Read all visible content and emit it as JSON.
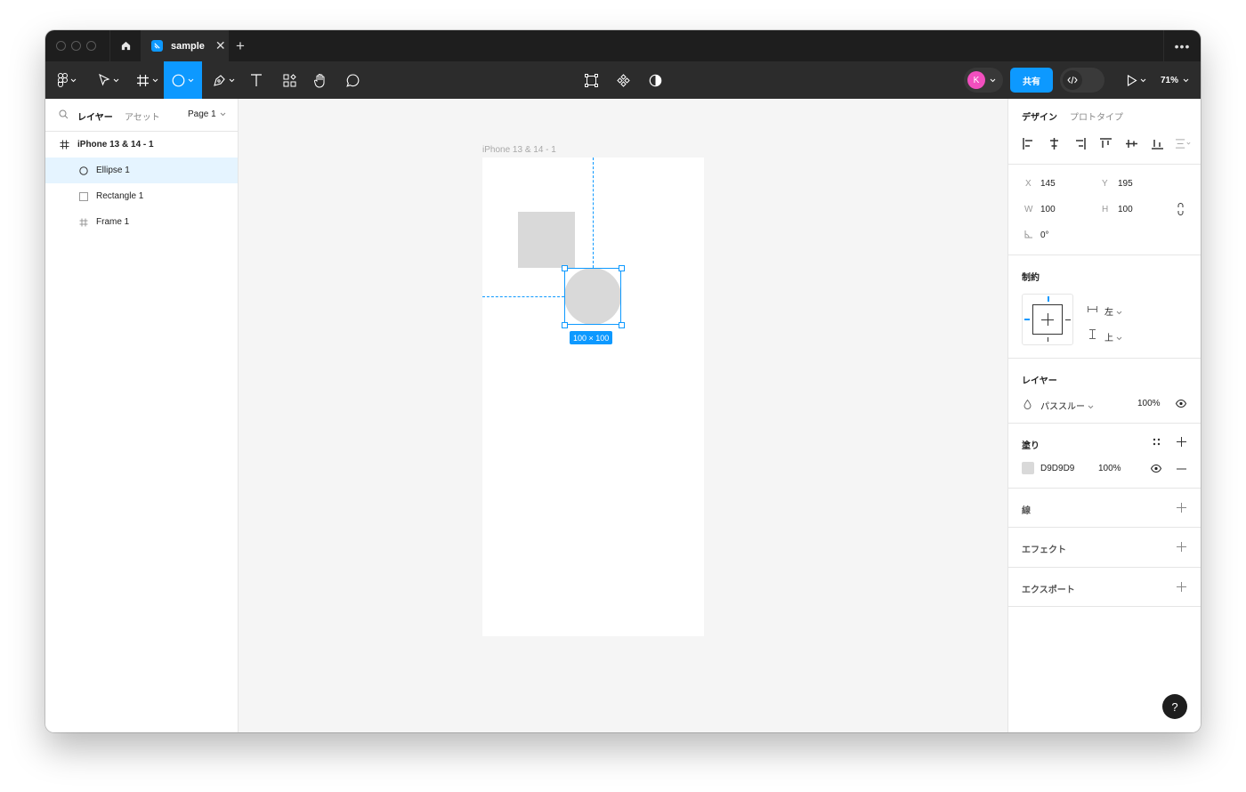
{
  "tabbar": {
    "file_title": "sample",
    "close_glyph": "✕",
    "add_glyph": "+",
    "more_glyph": "•••"
  },
  "toolbar": {
    "avatar_initial": "K",
    "share_label": "共有",
    "zoom": "71%"
  },
  "layers_panel": {
    "tab_layers": "レイヤー",
    "tab_assets": "アセット",
    "page": "Page 1",
    "items": [
      {
        "label": "iPhone 13 & 14 - 1",
        "icon": "frame-icon"
      },
      {
        "label": "Ellipse 1",
        "icon": "ellipse-icon"
      },
      {
        "label": "Rectangle 1",
        "icon": "rectangle-icon"
      },
      {
        "label": "Frame 1",
        "icon": "frame-icon"
      }
    ]
  },
  "canvas": {
    "frame_label": "iPhone 13 & 14 - 1",
    "size_badge": "100 × 100",
    "guide_color": "#0d99ff",
    "shape_fill": "#d9d9d9"
  },
  "design_panel": {
    "tab_design": "デザイン",
    "tab_prototype": "プロトタイプ",
    "x_label": "X",
    "x": "145",
    "y_label": "Y",
    "y": "195",
    "w_label": "W",
    "w": "100",
    "h_label": "H",
    "h": "100",
    "rotation": "0°",
    "constraints_title": "制約",
    "constraint_h": "左",
    "constraint_v": "上",
    "layer_title": "レイヤー",
    "blend_mode": "パススルー",
    "layer_opacity": "100%",
    "fill_title": "塗り",
    "fill_hex": "D9D9D9",
    "fill_opacity": "100%",
    "stroke_title": "線",
    "effects_title": "エフェクト",
    "export_title": "エクスポート",
    "help": "?"
  }
}
